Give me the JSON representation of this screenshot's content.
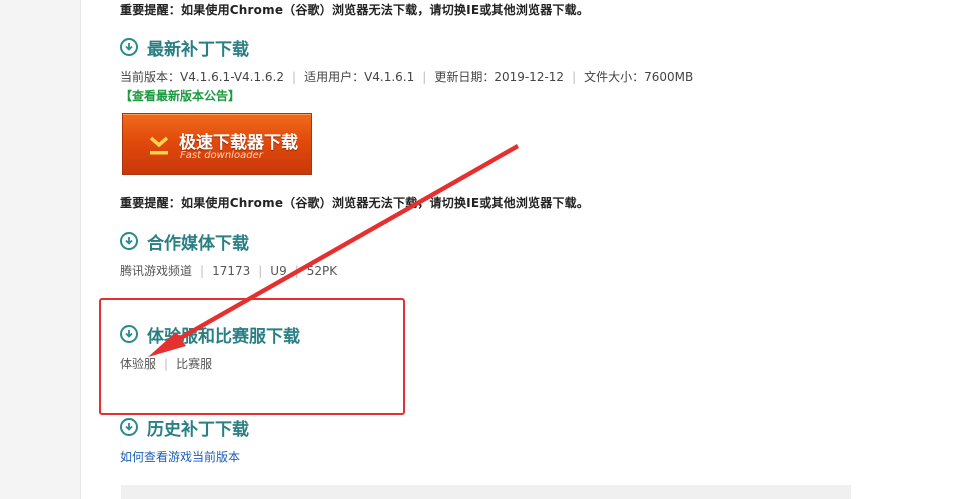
{
  "notices": {
    "top": "重要提醒：如果使用Chrome（谷歌）浏览器无法下载，请切换IE或其他浏览器下载。",
    "middle": "重要提醒：如果使用Chrome（谷歌）浏览器无法下载，请切换IE或其他浏览器下载。"
  },
  "patch": {
    "title": "最新补丁下载",
    "current_version": "当前版本：V4.1.6.1-V4.1.6.2",
    "applicable_users": "适用用户：V4.1.6.1",
    "update_date": "更新日期：2019-12-12",
    "file_size": "文件大小：7600MB",
    "announcement_link": "【查看最新版本公告】"
  },
  "fast_downloader": {
    "label": "极速下载器下载",
    "sublabel": "Fast downloader"
  },
  "media": {
    "title": "合作媒体下载",
    "items": [
      "腾讯游戏频道",
      "17173",
      "U9",
      "52PK"
    ]
  },
  "trial": {
    "title": "体验服和比赛服下载",
    "items": [
      "体验服",
      "比赛服"
    ]
  },
  "history": {
    "title": "历史补丁下载",
    "link": "如何查看游戏当前版本"
  },
  "colors": {
    "section_title": "#2a7f84",
    "link_green": "#1a9b3e",
    "link_blue": "#1b5fb3",
    "annotation_red": "#e53030",
    "button_orange": "#e24a0c"
  }
}
